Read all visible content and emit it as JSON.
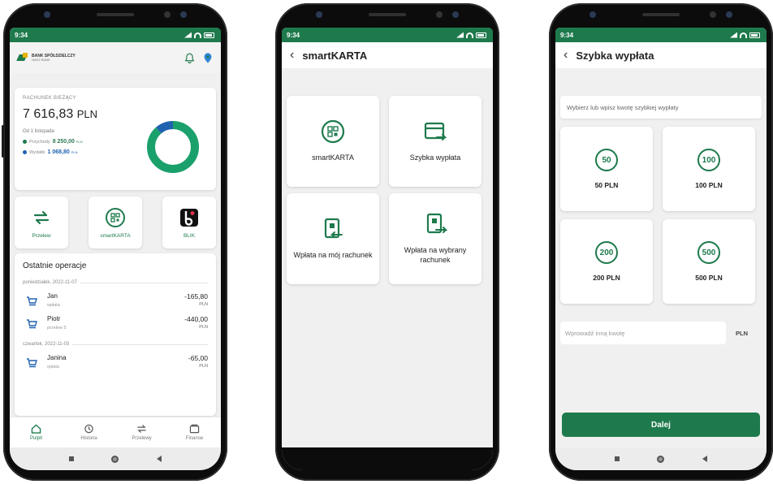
{
  "status": {
    "time": "9:34"
  },
  "phone1": {
    "bank_name": "BANK SPÓŁDZIELCZY",
    "bank_sub": "NASZ BANK",
    "account": {
      "label": "RACHUNEK BIEŻĄCY",
      "amount": "7 616,83",
      "currency": "PLN",
      "since": "Od 1 listopada",
      "income_label": "Przychody",
      "income_value": "8 250,00",
      "income_currency": "PLN",
      "expense_label": "Wydatki",
      "expense_value": "1 068,80",
      "expense_currency": "PLN",
      "income_color": "#1e7a4c",
      "expense_color": "#2062b0"
    },
    "donut": {
      "income_share": 0.885,
      "expense_share": 0.115
    },
    "quick": [
      {
        "label": "Przelew",
        "icon": "transfer-icon"
      },
      {
        "label": "smartKARTA",
        "icon": "smartkarta-icon"
      },
      {
        "label": "BLIK",
        "icon": "blik-icon"
      }
    ],
    "ops": {
      "title": "Ostatnie operacje",
      "groups": [
        {
          "date": "poniedziałek, 2022-11-07",
          "items": [
            {
              "name": "Jan",
              "sub": "wpłata",
              "amount": "-165,80",
              "currency": "PLN"
            },
            {
              "name": "Piotr",
              "sub": "przelew 5",
              "amount": "-440,00",
              "currency": "PLN"
            }
          ]
        },
        {
          "date": "czwartek, 2022-11-03",
          "items": [
            {
              "name": "Janina",
              "sub": "opłata",
              "amount": "-65,00",
              "currency": "PLN"
            }
          ]
        }
      ]
    },
    "nav": [
      {
        "label": "Pulpit",
        "icon": "home-icon",
        "active": true
      },
      {
        "label": "Historia",
        "icon": "history-icon",
        "active": false
      },
      {
        "label": "Przelewy",
        "icon": "transfers-icon",
        "active": false
      },
      {
        "label": "Finanse",
        "icon": "finance-icon",
        "active": false
      }
    ]
  },
  "phone2": {
    "title": "smartKARTA",
    "tiles": [
      {
        "label": "smartKARTA",
        "icon": "smartkarta-icon"
      },
      {
        "label": "Szybka wypłata",
        "icon": "quick-withdrawal-icon"
      },
      {
        "label": "Wpłata na mój rachunek",
        "icon": "deposit-own-icon"
      },
      {
        "label": "Wpłata na wybrany rachunek",
        "icon": "deposit-chosen-icon"
      }
    ]
  },
  "phone3": {
    "title": "Szybka wypłata",
    "hint": "Wybierz lub wpisz kwotę szybkiej wypłaty",
    "amounts": [
      {
        "coin": "50",
        "label": "50 PLN"
      },
      {
        "coin": "100",
        "label": "100 PLN"
      },
      {
        "coin": "200",
        "label": "200 PLN"
      },
      {
        "coin": "500",
        "label": "500 PLN"
      }
    ],
    "other_placeholder": "Wprowadź inną kwotę",
    "other_currency": "PLN",
    "next_label": "Dalej"
  },
  "colors": {
    "brand": "#1e7a4c",
    "accent_blue": "#2062b0"
  }
}
